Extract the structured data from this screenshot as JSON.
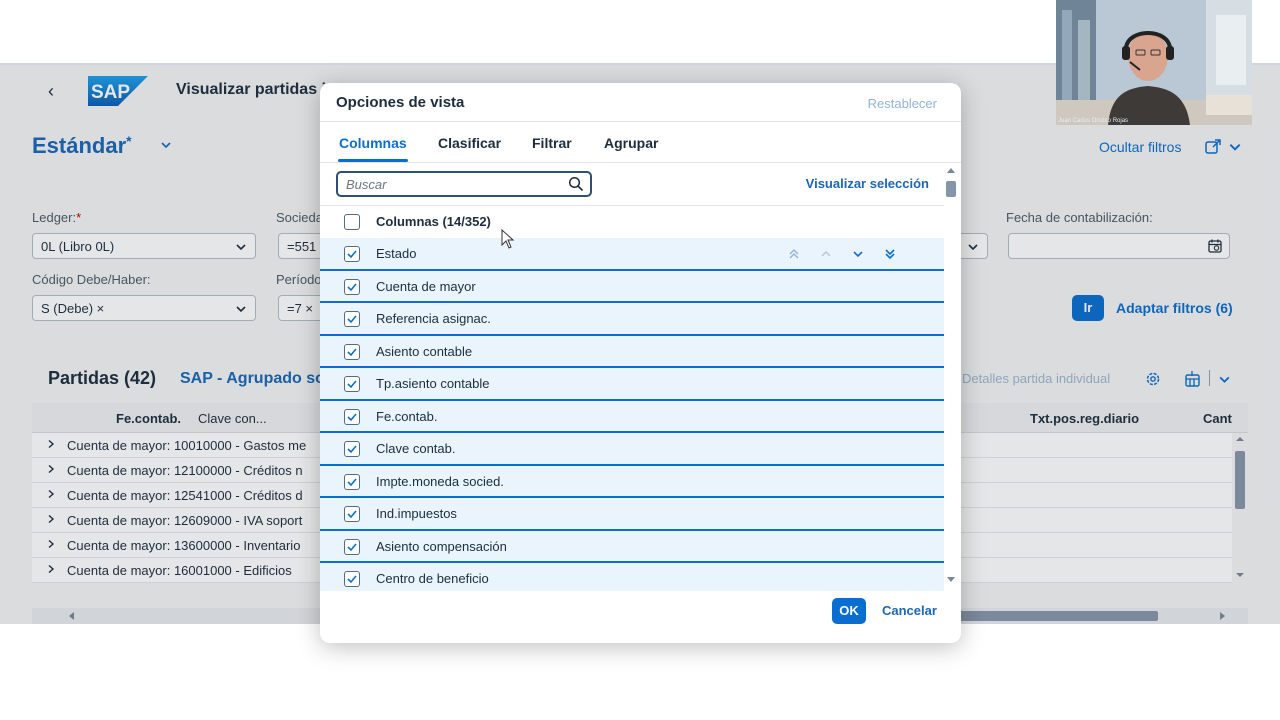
{
  "shell": {
    "logo_text": "SAP",
    "app_title": "Visualizar partidas i"
  },
  "variant": {
    "name": "Estándar",
    "modified_marker": "*"
  },
  "header_actions": {
    "hide_filters": "Ocultar filtros"
  },
  "filters": {
    "ledger": {
      "label": "Ledger:",
      "required_marker": "*",
      "value": "0L (Libro 0L)"
    },
    "company": {
      "label": "Socieda",
      "value": "=551"
    },
    "posting_date": {
      "label": "Fecha de contabilización:",
      "value": ""
    },
    "debit_credit": {
      "label": "Código Debe/Haber:",
      "token": "S (Debe)",
      "token_remove": "×"
    },
    "period": {
      "label": "Período",
      "value": "=7 ×"
    },
    "go": "Ir",
    "adapt": "Adaptar filtros (6)"
  },
  "table": {
    "title": "Partidas (42)",
    "variant": "SAP - Agrupado so",
    "single_item_details": "Detalles partida individual",
    "columns": [
      "Fe.contab.",
      "Clave con...",
      "Txt.pos.reg.diario",
      "Cant"
    ],
    "rows": [
      "Cuenta de mayor: 10010000 - Gastos me",
      "Cuenta de mayor: 12100000 - Créditos n",
      "Cuenta de mayor: 12541000 - Créditos d",
      "Cuenta de mayor: 12609000 - IVA soport",
      "Cuenta de mayor: 13600000 - Inventario",
      "Cuenta de mayor: 16001000 - Edificios"
    ]
  },
  "dialog": {
    "title": "Opciones de vista",
    "reset": "Restablecer",
    "tabs": [
      "Columnas",
      "Clasificar",
      "Filtrar",
      "Agrupar"
    ],
    "active_tab": "Columnas",
    "search": {
      "value": "",
      "placeholder": "Buscar"
    },
    "show_selected": "Visualizar selección",
    "header_item": {
      "label": "Columnas (14/352)",
      "checked": false
    },
    "items": [
      {
        "label": "Estado",
        "checked": true
      },
      {
        "label": "Cuenta de mayor",
        "checked": true
      },
      {
        "label": "Referencia asignac.",
        "checked": true
      },
      {
        "label": "Asiento contable",
        "checked": true
      },
      {
        "label": "Tp.asiento contable",
        "checked": true
      },
      {
        "label": "Fe.contab.",
        "checked": true
      },
      {
        "label": "Clave contab.",
        "checked": true
      },
      {
        "label": "Impte.moneda socied.",
        "checked": true
      },
      {
        "label": "Ind.impuestos",
        "checked": true
      },
      {
        "label": "Asiento compensación",
        "checked": true
      },
      {
        "label": "Centro de beneficio",
        "checked": true
      }
    ],
    "ok": "OK",
    "cancel": "Cancelar"
  },
  "webcam": {
    "caption": "Juan Carlos Orozco Rojas"
  },
  "colors": {
    "accent": "#0a6ed1",
    "brand_blue": "#1a66b8",
    "selected_row": "#eaf4fc"
  }
}
